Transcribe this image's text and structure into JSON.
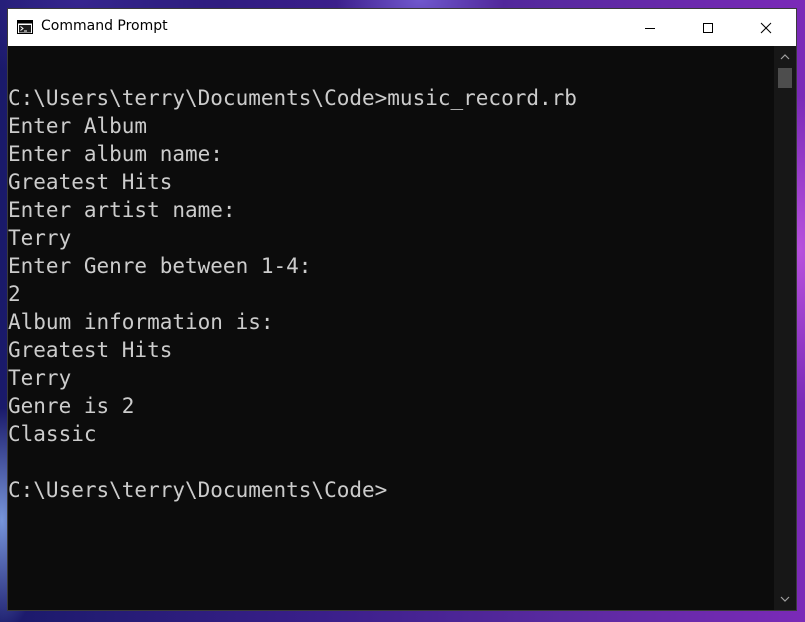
{
  "window": {
    "title": "Command Prompt",
    "icon": "cmd-icon",
    "controls": {
      "minimize_icon": "minimize-icon",
      "maximize_icon": "maximize-icon",
      "close_icon": "close-icon"
    }
  },
  "console": {
    "lines": [
      "",
      "C:\\Users\\terry\\Documents\\Code>music_record.rb",
      "Enter Album",
      "Enter album name:",
      "Greatest Hits",
      "Enter artist name:",
      "Terry",
      "Enter Genre between 1-4:",
      "2",
      "Album information is:",
      "Greatest Hits",
      "Terry",
      "Genre is 2",
      "Classic",
      "",
      "C:\\Users\\terry\\Documents\\Code>"
    ]
  },
  "scrollbar": {
    "up_icon": "scroll-up-icon",
    "down_icon": "scroll-down-icon"
  },
  "colors": {
    "console_background": "#0c0c0c",
    "console_text": "#cccccc",
    "titlebar": "#ffffff"
  }
}
